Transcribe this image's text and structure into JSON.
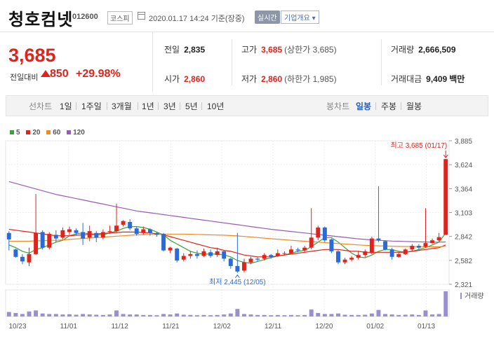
{
  "header": {
    "name": "청호컴넷",
    "code": "012600",
    "market": "코스피",
    "time": "2020.01.17 14:24 기준(장중)",
    "realtime_label": "실시간",
    "overview_label": "기업개요 ▾"
  },
  "price": {
    "current": "3,685",
    "diff_label": "전일대비",
    "diff": "850",
    "pct": "+29.98%"
  },
  "stats": {
    "prev_label": "전일",
    "prev": "2,835",
    "high_label": "고가",
    "high": "3,685",
    "high_sub": "(상한가 3,685)",
    "volume_label": "거래량",
    "volume": "2,666,509",
    "open_label": "시가",
    "open": "2,860",
    "low_label": "저가",
    "low": "2,860",
    "low_sub": "(하한가 1,985)",
    "amount_label": "거래대금",
    "amount": "9,409",
    "amount_unit": "백만"
  },
  "tabs": {
    "line_label": "선차트",
    "line_items": [
      "1일",
      "1주일",
      "3개월",
      "1년",
      "3년",
      "5년",
      "10년"
    ],
    "candle_label": "봉차트",
    "candle_items": [
      "일봉",
      "주봉",
      "월봉"
    ],
    "candle_selected": "일봉"
  },
  "legend": [
    {
      "label": "5",
      "color": "#3aa335"
    },
    {
      "label": "20",
      "color": "#e0231c"
    },
    {
      "label": "60",
      "color": "#f08a24"
    },
    {
      "label": "120",
      "color": "#9b59b6"
    }
  ],
  "chart_data": {
    "type": "candlestick",
    "y_ticks": [
      "3,885",
      "3,624",
      "3,364",
      "3,103",
      "2,842",
      "2,582",
      "2,321"
    ],
    "ylim": [
      2321,
      3885
    ],
    "x_ticks": [
      "10/23",
      "11/01",
      "11/12",
      "11/21",
      "12/02",
      "12/11",
      "12/20",
      "01/02",
      "01/13"
    ],
    "max_annotation": "최고 3,685 (01/17)",
    "min_annotation": "최저 2,445 (12/05)",
    "volume_label": "거래량",
    "up_color": "#e0231c",
    "down_color": "#2a6bd6",
    "candles": [
      [
        2880,
        2810,
        2900,
        2690
      ],
      [
        2700,
        2620,
        2710,
        2610
      ],
      [
        2620,
        2570,
        2650,
        2540
      ],
      [
        2560,
        2650,
        2720,
        2520
      ],
      [
        2650,
        2880,
        3305,
        2640
      ],
      [
        2890,
        2720,
        2910,
        2700
      ],
      [
        2720,
        2870,
        2890,
        2700
      ],
      [
        2860,
        2820,
        2910,
        2780
      ],
      [
        2830,
        2910,
        2940,
        2810
      ],
      [
        2890,
        2920,
        2950,
        2860
      ],
      [
        2910,
        2880,
        2930,
        2850
      ],
      [
        2890,
        2820,
        2990,
        2750
      ],
      [
        2830,
        2900,
        2960,
        2790
      ],
      [
        2880,
        2830,
        2900,
        2780
      ],
      [
        2830,
        2890,
        2920,
        2810
      ],
      [
        2890,
        2900,
        2960,
        2870
      ],
      [
        2900,
        2960,
        3200,
        2880
      ],
      [
        2970,
        3010,
        3020,
        2950
      ],
      [
        3000,
        2930,
        3030,
        2910
      ],
      [
        2930,
        2870,
        2950,
        2850
      ],
      [
        2880,
        2920,
        2950,
        2860
      ],
      [
        2920,
        2880,
        2930,
        2850
      ],
      [
        2880,
        2860,
        2890,
        2840
      ],
      [
        2870,
        2690,
        2880,
        2680
      ],
      [
        2690,
        2720,
        2730,
        2660
      ],
      [
        2710,
        2580,
        2720,
        2560
      ],
      [
        2590,
        2630,
        2660,
        2570
      ],
      [
        2630,
        2650,
        2680,
        2600
      ],
      [
        2650,
        2630,
        2690,
        2600
      ],
      [
        2630,
        2680,
        2710,
        2620
      ],
      [
        2670,
        2630,
        2700,
        2610
      ],
      [
        2640,
        2680,
        2720,
        2620
      ],
      [
        2680,
        2600,
        2690,
        2570
      ],
      [
        2600,
        2520,
        2610,
        2490
      ],
      [
        2520,
        2460,
        2880,
        2445
      ],
      [
        2470,
        2560,
        2600,
        2450
      ],
      [
        2560,
        2600,
        2620,
        2540
      ],
      [
        2600,
        2590,
        2620,
        2570
      ],
      [
        2600,
        2640,
        2660,
        2580
      ],
      [
        2640,
        2620,
        2650,
        2600
      ],
      [
        2630,
        2660,
        2700,
        2620
      ],
      [
        2660,
        2660,
        2680,
        2640
      ],
      [
        2660,
        2700,
        2740,
        2650
      ],
      [
        2700,
        2690,
        2720,
        2670
      ],
      [
        2690,
        2720,
        2740,
        2670
      ],
      [
        2720,
        2830,
        3150,
        2700
      ],
      [
        2830,
        2940,
        2960,
        2800
      ],
      [
        2940,
        2800,
        2950,
        2780
      ],
      [
        2810,
        2680,
        2820,
        2660
      ],
      [
        2680,
        2560,
        2700,
        2540
      ],
      [
        2560,
        2590,
        2610,
        2540
      ],
      [
        2590,
        2610,
        2630,
        2570
      ],
      [
        2610,
        2640,
        2680,
        2590
      ],
      [
        2640,
        2680,
        2700,
        2620
      ],
      [
        2660,
        2820,
        2840,
        2650
      ],
      [
        2820,
        2800,
        3390,
        2780
      ],
      [
        2790,
        2700,
        2800,
        2690
      ],
      [
        2700,
        2620,
        2720,
        2590
      ],
      [
        2620,
        2650,
        2670,
        2610
      ],
      [
        2650,
        2700,
        2710,
        2640
      ],
      [
        2700,
        2740,
        2760,
        2680
      ],
      [
        2740,
        2720,
        2760,
        2700
      ],
      [
        2730,
        2770,
        3150,
        2720
      ],
      [
        2770,
        2800,
        2820,
        2760
      ],
      [
        2800,
        2835,
        2880,
        2790
      ],
      [
        2860,
        3685,
        3685,
        2860
      ]
    ],
    "volume": [
      18,
      14,
      10,
      20,
      24,
      12,
      10,
      10,
      8,
      9,
      7,
      10,
      8,
      7,
      6,
      8,
      24,
      10,
      8,
      8,
      6,
      6,
      5,
      10,
      8,
      12,
      7,
      6,
      5,
      6,
      5,
      6,
      8,
      12,
      30,
      10,
      8,
      6,
      6,
      5,
      6,
      5,
      6,
      5,
      6,
      28,
      14,
      10,
      10,
      12,
      7,
      6,
      6,
      7,
      12,
      26,
      10,
      8,
      6,
      7,
      8,
      6,
      24,
      8,
      10,
      100
    ],
    "ma": {
      "ma5": [
        2750,
        2720,
        2680,
        2660,
        2700,
        2720,
        2750,
        2780,
        2800,
        2850,
        2870,
        2880,
        2870,
        2860,
        2860,
        2880,
        2900,
        2930,
        2950,
        2950,
        2940,
        2920,
        2890,
        2860,
        2800,
        2760,
        2720,
        2680,
        2660,
        2650,
        2650,
        2650,
        2640,
        2620,
        2580,
        2560,
        2550,
        2570,
        2590,
        2610,
        2630,
        2640,
        2660,
        2680,
        2690,
        2730,
        2780,
        2830,
        2830,
        2780,
        2720,
        2660,
        2620,
        2610,
        2640,
        2680,
        2700,
        2700,
        2680,
        2670,
        2680,
        2700,
        2720,
        2750,
        2780,
        2880
      ],
      "ma20": [
        2920,
        2910,
        2900,
        2890,
        2880,
        2870,
        2860,
        2850,
        2850,
        2850,
        2855,
        2860,
        2865,
        2870,
        2875,
        2880,
        2885,
        2890,
        2890,
        2890,
        2885,
        2880,
        2870,
        2860,
        2840,
        2820,
        2800,
        2780,
        2760,
        2740,
        2720,
        2710,
        2690,
        2680,
        2660,
        2640,
        2630,
        2620,
        2620,
        2620,
        2630,
        2640,
        2650,
        2660,
        2670,
        2680,
        2690,
        2700,
        2700,
        2700,
        2690,
        2680,
        2680,
        2670,
        2670,
        2670,
        2670,
        2670,
        2670,
        2670,
        2680,
        2690,
        2700,
        2710,
        2720,
        2750
      ],
      "ma60": [
        2790,
        2790,
        2790,
        2790,
        2795,
        2795,
        2800,
        2800,
        2805,
        2810,
        2815,
        2820,
        2825,
        2830,
        2835,
        2840,
        2845,
        2850,
        2855,
        2860,
        2862,
        2864,
        2866,
        2868,
        2868,
        2868,
        2868,
        2866,
        2864,
        2862,
        2860,
        2858,
        2856,
        2852,
        2848,
        2842,
        2836,
        2830,
        2824,
        2818,
        2812,
        2806,
        2800,
        2795,
        2790,
        2785,
        2780,
        2775,
        2770,
        2765,
        2760,
        2755,
        2750,
        2746,
        2742,
        2740,
        2738,
        2736,
        2734,
        2733,
        2732,
        2731,
        2731,
        2730,
        2730,
        2735
      ],
      "ma120": [
        3440,
        3420,
        3400,
        3380,
        3360,
        3340,
        3320,
        3300,
        3285,
        3270,
        3255,
        3240,
        3225,
        3210,
        3195,
        3180,
        3165,
        3150,
        3135,
        3120,
        3110,
        3100,
        3090,
        3080,
        3070,
        3060,
        3050,
        3040,
        3030,
        3020,
        3010,
        3000,
        2990,
        2980,
        2970,
        2960,
        2950,
        2940,
        2930,
        2920,
        2912,
        2904,
        2896,
        2888,
        2880,
        2872,
        2864,
        2856,
        2848,
        2840,
        2832,
        2824,
        2816,
        2810,
        2804,
        2800,
        2796,
        2792,
        2790,
        2788,
        2786,
        2784,
        2782,
        2780,
        2780,
        2782
      ]
    }
  }
}
